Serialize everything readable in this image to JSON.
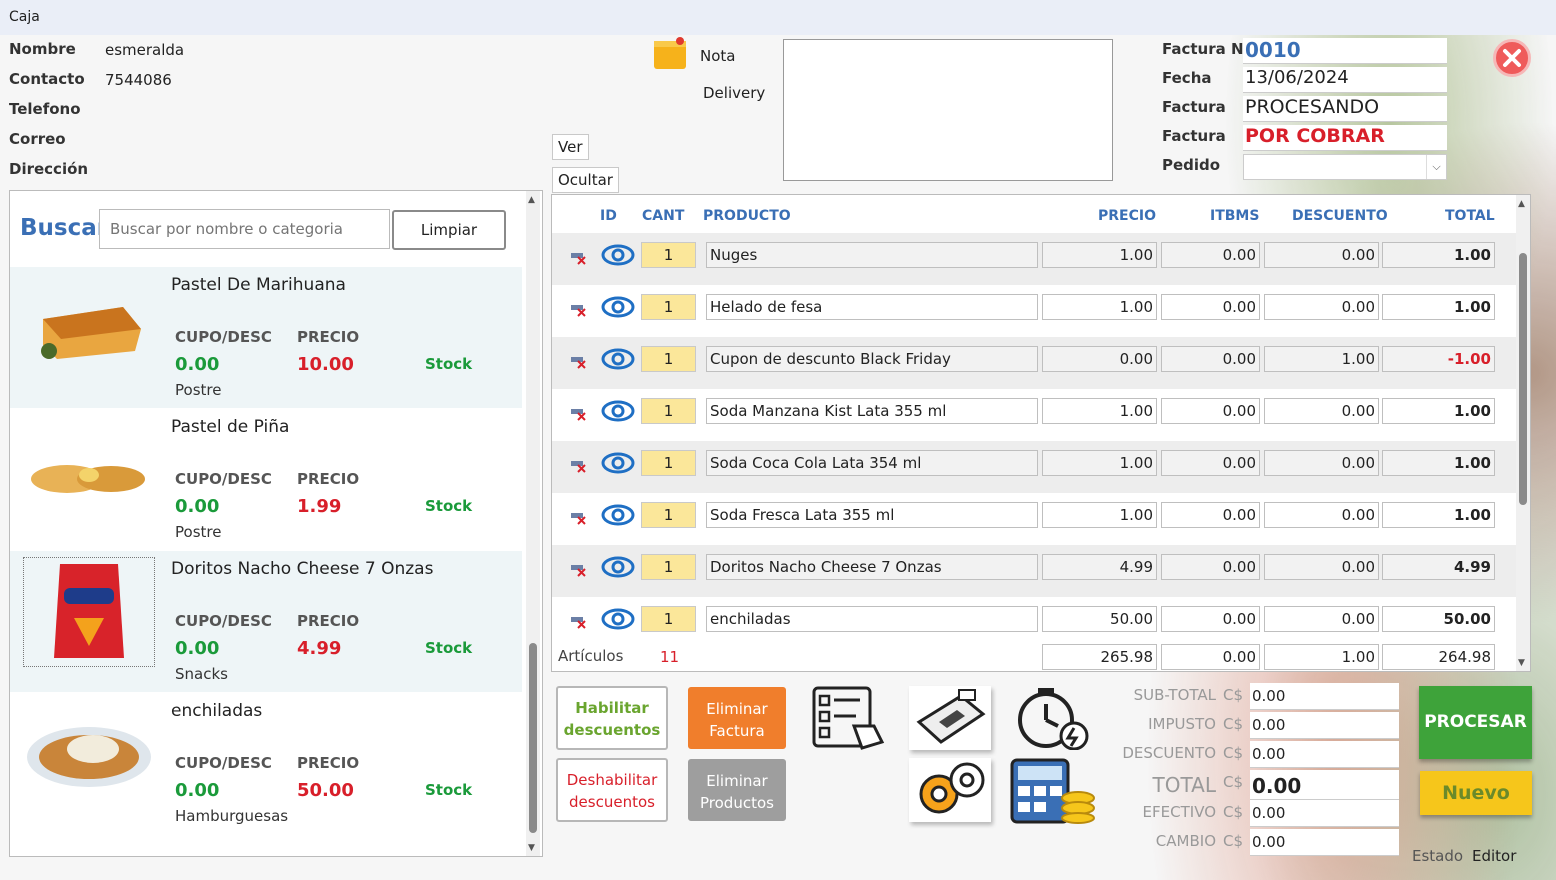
{
  "window": {
    "title": "Caja"
  },
  "customer": {
    "labels": [
      "Nombre",
      "Contacto",
      "Telefono",
      "Correo",
      "Dirección"
    ],
    "nombre": "esmeralda",
    "contacto": "7544086"
  },
  "note": {
    "nota_label": "Nota",
    "delivery_label": "Delivery",
    "ver_label": "Ver",
    "ocultar_label": "Ocultar"
  },
  "invoice": {
    "labels": [
      "Factura N",
      "Fecha",
      "Factura",
      "Factura",
      "Pedido"
    ],
    "number": "0010",
    "date": "13/06/2024",
    "status": "PROCESANDO",
    "payment_status": "POR COBRAR",
    "pedido": ""
  },
  "search": {
    "label": "Buscar",
    "placeholder": "Buscar por nombre o categoria",
    "clear_label": "Limpiar"
  },
  "catalog": {
    "cupo_label": "CUPO/DESC",
    "precio_label": "PRECIO",
    "stock_label": "Stock",
    "items": [
      {
        "name": "Pastel De Marihuana",
        "cupo": "0.00",
        "precio": "10.00",
        "category": "Postre"
      },
      {
        "name": "Pastel de Piña",
        "cupo": "0.00",
        "precio": "1.99",
        "category": "Postre"
      },
      {
        "name": "Doritos Nacho Cheese 7 Onzas",
        "cupo": "0.00",
        "precio": "4.99",
        "category": "Snacks"
      },
      {
        "name": "enchiladas",
        "cupo": "0.00",
        "precio": "50.00",
        "category": "Hamburguesas"
      }
    ]
  },
  "grid": {
    "headers": {
      "id": "ID",
      "cant": "CANT",
      "producto": "PRODUCTO",
      "precio": "PRECIO",
      "itbms": "ITBMS",
      "descuento": "DESCUENTO",
      "total": "TOTAL"
    },
    "rows": [
      {
        "cant": "1",
        "producto": "Nuges",
        "precio": "1.00",
        "itbms": "0.00",
        "descuento": "0.00",
        "total": "1.00"
      },
      {
        "cant": "1",
        "producto": "Helado de fesa",
        "precio": "1.00",
        "itbms": "0.00",
        "descuento": "0.00",
        "total": "1.00"
      },
      {
        "cant": "1",
        "producto": "Cupon de descunto  Black Friday",
        "precio": "0.00",
        "itbms": "0.00",
        "descuento": "1.00",
        "total": "-1.00"
      },
      {
        "cant": "1",
        "producto": "Soda Manzana Kist  Lata 355 ml",
        "precio": "1.00",
        "itbms": "0.00",
        "descuento": "0.00",
        "total": "1.00"
      },
      {
        "cant": "1",
        "producto": "Soda Coca Cola Lata 354 ml",
        "precio": "1.00",
        "itbms": "0.00",
        "descuento": "0.00",
        "total": "1.00"
      },
      {
        "cant": "1",
        "producto": "Soda Fresca Lata 355 ml",
        "precio": "1.00",
        "itbms": "0.00",
        "descuento": "0.00",
        "total": "1.00"
      },
      {
        "cant": "1",
        "producto": "Doritos Nacho Cheese 7 Onzas",
        "precio": "4.99",
        "itbms": "0.00",
        "descuento": "0.00",
        "total": "4.99"
      },
      {
        "cant": "1",
        "producto": "enchiladas",
        "precio": "50.00",
        "itbms": "0.00",
        "descuento": "0.00",
        "total": "50.00"
      }
    ],
    "articulos_label": "Artículos",
    "articulos_count": "11",
    "totals": {
      "precio": "265.98",
      "itbms": "0.00",
      "descuento": "1.00",
      "total": "264.98"
    }
  },
  "actions": {
    "habilitar": "Habilitar descuentos",
    "deshabilitar": "Deshabilitar descuentos",
    "eliminar_factura": "Eliminar Factura",
    "eliminar_productos": "Eliminar Productos"
  },
  "summary": {
    "currency": "C$",
    "subtotal_label": "SUB-TOTAL",
    "subtotal": "0.00",
    "impuesto_label": "IMPUSTO",
    "impuesto": "0.00",
    "descuento_label": "DESCUENTO",
    "descuento": "0.00",
    "total_label": "TOTAL",
    "total": "0.00",
    "efectivo_label": "EFECTIVO",
    "efectivo": "0.00",
    "cambio_label": "CAMBIO",
    "cambio": "0.00"
  },
  "buttons": {
    "procesar": "PROCESAR",
    "nuevo": "Nuevo"
  },
  "status": {
    "estado_label": "Estado",
    "estado_value": "Editor"
  },
  "colors": {
    "accent_blue": "#3a6fb5",
    "green": "#1a9a3a",
    "red": "#d81f2a",
    "procesar": "#3ea33a",
    "nuevo": "#f6c61b",
    "eliminar_factura": "#f07e2c",
    "eliminar_productos": "#9e9e9e"
  }
}
